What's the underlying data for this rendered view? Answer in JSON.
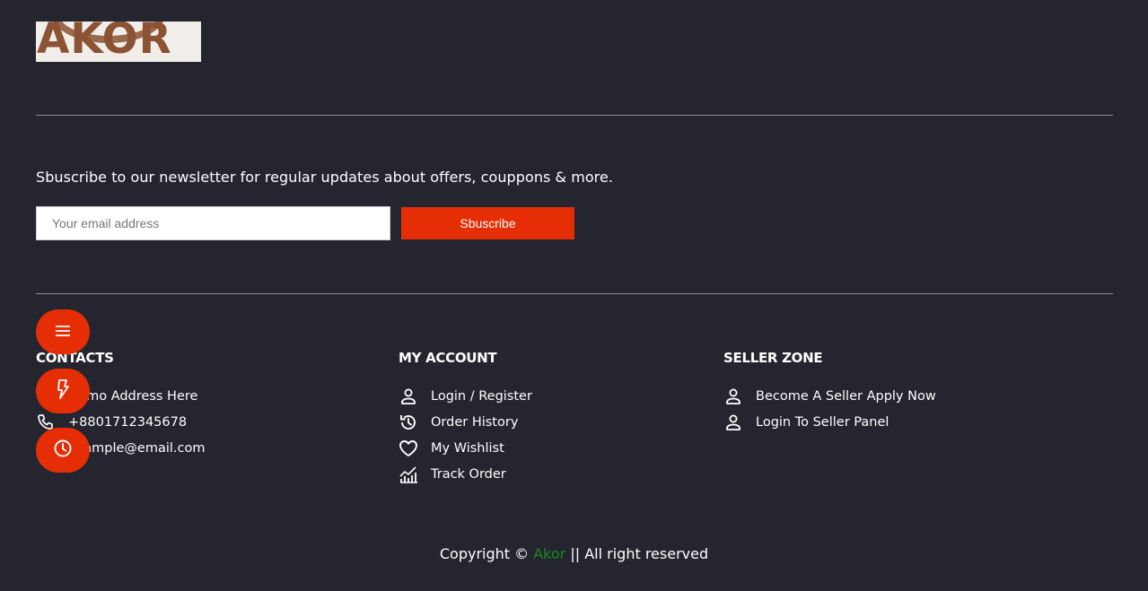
{
  "brand": {
    "logo_text": "AKOR",
    "name": "Akor",
    "accent_color": "#1b8a1b",
    "primary_color": "#e52e06"
  },
  "newsletter": {
    "text": "Sbuscribe to our newsletter for regular updates about offers, couppons & more.",
    "email_placeholder": "Your email address",
    "email_value": "",
    "button_label": "Sbuscribe"
  },
  "contacts": {
    "title": "CONTACTS",
    "items": [
      {
        "icon": "location-icon",
        "label": "Demo Address Here"
      },
      {
        "icon": "phone-icon",
        "label": "+8801712345678"
      },
      {
        "icon": "email-icon",
        "label": "example@email.com"
      }
    ]
  },
  "my_account": {
    "title": "MY ACCOUNT",
    "items": [
      {
        "icon": "user-icon",
        "label": "Login / Register"
      },
      {
        "icon": "history-icon",
        "label": "Order History"
      },
      {
        "icon": "heart-icon",
        "label": "My Wishlist"
      },
      {
        "icon": "chart-icon",
        "label": "Track Order"
      }
    ]
  },
  "seller_zone": {
    "title": "SELLER ZONE",
    "items": [
      {
        "icon": "user-icon",
        "label": "Become A Seller",
        "extra": "Apply Now"
      },
      {
        "icon": "user-icon",
        "label": "Login To Seller Panel"
      }
    ]
  },
  "floating_buttons": [
    {
      "icon": "menu-icon"
    },
    {
      "icon": "flash-icon"
    },
    {
      "icon": "clock-icon"
    }
  ],
  "footer": {
    "copyright_prefix": "Copyright ©",
    "brand": "Akor",
    "copyright_suffix": "|| All right reserved"
  }
}
